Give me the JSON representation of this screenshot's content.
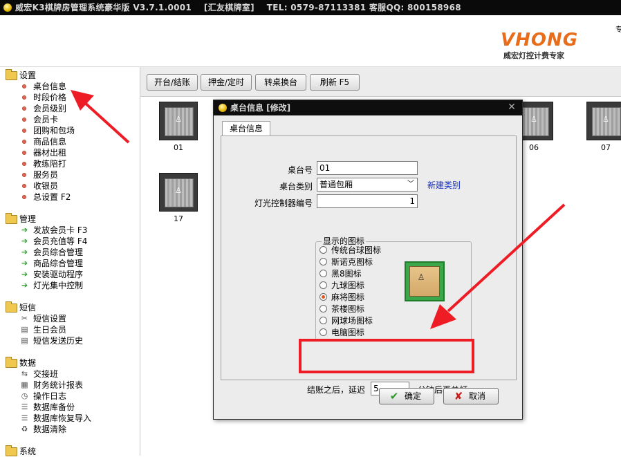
{
  "window": {
    "title_parts": [
      "威宏K3棋牌房管理系统豪华版 V3.7.1.0001",
      "[汇友棋牌室]",
      "TEL: 0579-87113381 客服QQ: 800158968"
    ]
  },
  "banner": {
    "brand": "VHONG",
    "slogan": "威宏灯控计费专家",
    "corner_text": "专"
  },
  "sidebar": {
    "groups": [
      {
        "label": "设置",
        "items": [
          "桌台信息",
          "时段价格",
          "会员级别",
          "会员卡",
          "团购和包场",
          "商品信息",
          "器材出租",
          "教练陪打",
          "服务员",
          "收银员",
          "总设置 F2"
        ]
      },
      {
        "label": "管理",
        "items": [
          "发放会员卡 F3",
          "会员充值等 F4",
          "会员综合管理",
          "商品综合管理",
          "安装驱动程序",
          "灯光集中控制"
        ]
      },
      {
        "label": "短信",
        "items": [
          "短信设置",
          "生日会员",
          "短信发送历史"
        ]
      },
      {
        "label": "数据",
        "items": [
          "交接班",
          "财务统计报表",
          "操作日志",
          "数据库备份",
          "数据库恢复导入",
          "数据清除"
        ]
      },
      {
        "label": "系统",
        "items": []
      }
    ]
  },
  "toolbar": {
    "buttons": [
      "开台/结账",
      "押金/定时",
      "转桌换台",
      "刷新 F5"
    ]
  },
  "tables": [
    "01",
    "06",
    "07",
    "17"
  ],
  "dialog": {
    "title": "桌台信息 [修改]",
    "tab": "桌台信息",
    "fields": {
      "table_no_label": "桌台号",
      "table_no_value": "01",
      "category_label": "桌台类别",
      "category_value": "普通包厢",
      "new_category_link": "新建类别",
      "controller_label": "灯光控制器编号",
      "controller_value": "1"
    },
    "icon_group": {
      "legend": "显示的图标",
      "options": [
        "传统台球图标",
        "斯诺克图标",
        "黑8图标",
        "九球图标",
        "麻将图标",
        "茶楼图标",
        "网球场图标",
        "电脑图标"
      ],
      "selected": "麻将图标"
    },
    "delay": {
      "prefix": "结账之后，延迟",
      "value": "5",
      "suffix": "分钟后再关灯"
    },
    "ok_label": "确定",
    "cancel_label": "取消"
  },
  "colors": {
    "annotation_red": "#ee1c24",
    "brand_orange": "#e86d1a",
    "link_blue": "#1530c8"
  }
}
